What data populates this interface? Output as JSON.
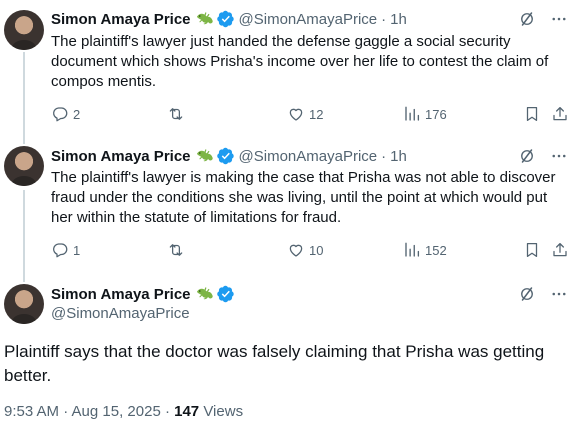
{
  "author": {
    "name": "Simon Amaya Price",
    "handle": "@SimonAmayaPrice",
    "emoji": "lizard-emoji",
    "verified_color": "#1d9bf0"
  },
  "tweets": [
    {
      "time": "1h",
      "text": "The plaintiff's lawyer just handed the defense gaggle a social security document which shows Prisha's income over her life to contest the claim of compos mentis.",
      "replies": "2",
      "reposts": "",
      "likes": "12",
      "views": "176"
    },
    {
      "time": "1h",
      "text": "The plaintiff's lawyer is making the case that Prisha was not able to discover fraud under the conditions she was living, until the point at which would put her within the statute of limitations for fraud.",
      "replies": "1",
      "reposts": "",
      "likes": "10",
      "views": "152"
    }
  ],
  "main": {
    "text": "Plaintiff says that the doctor was falsely claiming that Prisha was getting better.",
    "timestamp": "9:53 AM · Aug 15, 2025 · ",
    "views_count": "147",
    "views_label": " Views"
  },
  "icons": {
    "grok": "grok-slash-icon",
    "more": "more-dots-icon",
    "reply": "reply-bubble-icon",
    "repost": "repost-arrows-icon",
    "like": "heart-icon",
    "views": "views-bars-icon",
    "bookmark": "bookmark-icon",
    "share": "share-upload-icon"
  },
  "colors": {
    "text": "#0f1419",
    "secondary": "#536471",
    "line": "#cfd9de",
    "verified": "#1d9bf0"
  }
}
